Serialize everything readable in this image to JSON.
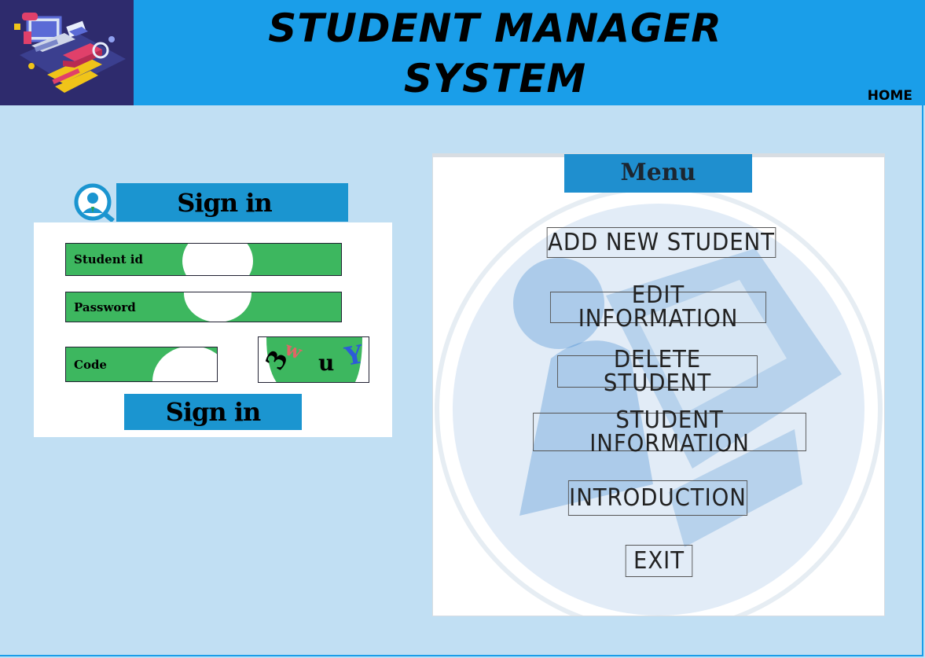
{
  "header": {
    "title_line1": "STUDENT MANAGER",
    "title_line2": "SYSTEM",
    "home_label": "HOME"
  },
  "signin": {
    "title": "Sign in",
    "student_id_label": "Student id",
    "password_label": "Password",
    "code_label": "Code",
    "captcha_chars": [
      "3",
      "w",
      "u",
      "Y"
    ],
    "button_label": "Sign in"
  },
  "menu": {
    "title": "Menu",
    "items": [
      "ADD NEW STUDENT",
      "EDIT INFORMATION",
      "DELETE STUDENT",
      "STUDENT INFORMATION",
      "INTRODUCTION",
      "EXIT"
    ]
  },
  "colors": {
    "header_bg": "#1a9ee9",
    "page_bg": "#c1dff3",
    "panel_accent": "#1b95d0",
    "field_green": "#3db75f",
    "logo_bg": "#2e2b6d"
  }
}
